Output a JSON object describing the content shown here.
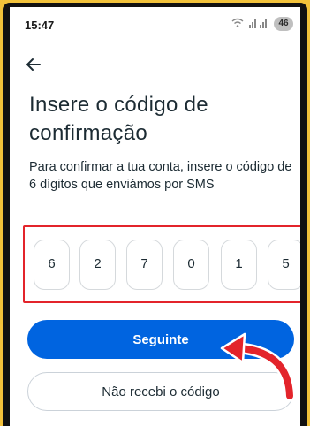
{
  "status_bar": {
    "time": "15:47",
    "wifi_icon": "wifi-icon",
    "signal_icon": "signal-icon",
    "battery_level": "46"
  },
  "nav": {
    "back_icon": "arrow-left-icon"
  },
  "header": {
    "title": "Insere o código de confirmação",
    "subtitle": "Para confirmar a tua conta, insere o código de 6 dígitos que enviámos por SMS"
  },
  "code": {
    "digits": [
      "6",
      "2",
      "7",
      "0",
      "1",
      "5"
    ]
  },
  "buttons": {
    "next_label": "Seguinte",
    "not_received_label": "Não recebi o código"
  },
  "colors": {
    "primary": "#0064e0",
    "highlight": "#e3242b",
    "background_accent": "#f2c23a"
  }
}
